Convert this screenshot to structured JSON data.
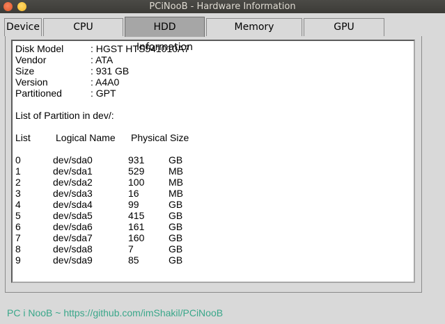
{
  "window": {
    "title": "PCiNooB - Hardware Information"
  },
  "tabs": [
    {
      "label": "Device"
    },
    {
      "label": "CPU Information"
    },
    {
      "label": "HDD Information"
    },
    {
      "label": "Memory Information"
    },
    {
      "label": "GPU Information"
    }
  ],
  "active_tab": "HDD Information",
  "disk": {
    "fields": [
      {
        "label": "Disk Model",
        "value": ": HGST HTS541010A7"
      },
      {
        "label": "Vendor",
        "value": ": ATA"
      },
      {
        "label": "Size",
        "value": ": 931 GB"
      },
      {
        "label": "Version",
        "value": ": A4A0"
      },
      {
        "label": "Partitioned",
        "value": ": GPT"
      }
    ],
    "partition_heading": "List of Partition in dev/:",
    "columns": {
      "list": "List",
      "name": "Logical Name",
      "size": "Physical Size"
    },
    "partitions": [
      {
        "list": "0",
        "name": "dev/sda0",
        "size": "931",
        "unit": "GB"
      },
      {
        "list": "1",
        "name": "dev/sda1",
        "size": "529",
        "unit": "MB"
      },
      {
        "list": "2",
        "name": "dev/sda2",
        "size": "100",
        "unit": "MB"
      },
      {
        "list": "3",
        "name": "dev/sda3",
        "size": "16",
        "unit": "MB"
      },
      {
        "list": "4",
        "name": "dev/sda4",
        "size": "99",
        "unit": "GB"
      },
      {
        "list": "5",
        "name": "dev/sda5",
        "size": "415",
        "unit": "GB"
      },
      {
        "list": "6",
        "name": "dev/sda6",
        "size": "161",
        "unit": "GB"
      },
      {
        "list": "7",
        "name": "dev/sda7",
        "size": "160",
        "unit": "GB"
      },
      {
        "list": "8",
        "name": "dev/sda8",
        "size": "7",
        "unit": "GB"
      },
      {
        "list": "9",
        "name": "dev/sda9",
        "size": "85",
        "unit": "GB"
      }
    ]
  },
  "footer": {
    "text": "PC i NooB ~ https://github.com/imShakil/PCiNooB"
  },
  "colors": {
    "footer_text": "#3aa78a",
    "titlebar": "#3c3b37"
  }
}
